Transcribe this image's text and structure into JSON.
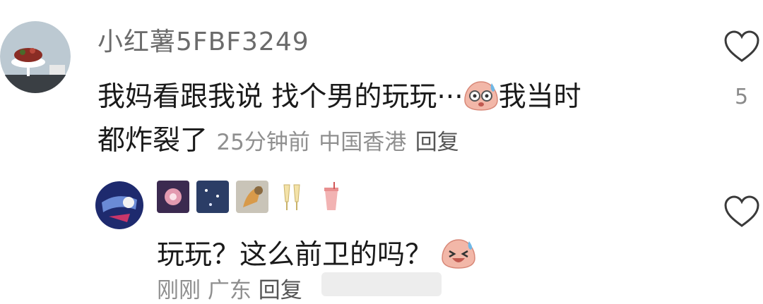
{
  "comment1": {
    "username": "小红薯5FBF3249",
    "text_line1": "我妈看跟我说 找个男的玩玩···",
    "text_line1_after": "我当时",
    "text_line2": "都炸裂了",
    "time": "25分钟前",
    "location": "中国香港",
    "reply_label": "回复",
    "like_count": "5"
  },
  "comment2": {
    "text": "玩玩？这么前卫的吗？",
    "time": "刚刚",
    "location": "广东",
    "reply_label": "回复"
  },
  "icons": [
    "avatar",
    "nickname-image-icon",
    "sweat-face-emoji-icon",
    "laughing-face-emoji-icon",
    "heart-icon"
  ],
  "colors": {
    "text": "#1a1a1a",
    "meta": "#8f8f8f",
    "username": "#6b6b6b"
  }
}
